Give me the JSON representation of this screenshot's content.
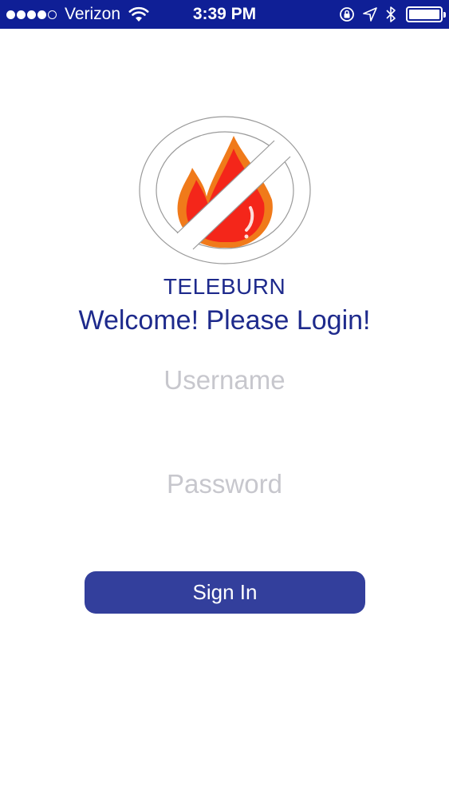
{
  "status_bar": {
    "carrier": "Verizon",
    "time": "3:39 PM",
    "signal_bars_filled": 4,
    "signal_bars_total": 5,
    "icons": [
      "wifi-icon",
      "rotation-lock-icon",
      "location-arrow-icon",
      "bluetooth-icon",
      "battery-icon"
    ],
    "battery_level": 1.0,
    "background_color": "#0f1f96"
  },
  "logo": {
    "icon": "no-fire-icon",
    "flame_color": "#f4261a",
    "flame_outline_color": "#f07a1a"
  },
  "header": {
    "app_name": "TELEBURN",
    "welcome": "Welcome! Please Login!",
    "text_color": "#1e2a8c"
  },
  "form": {
    "username_placeholder": "Username",
    "username_value": "",
    "password_placeholder": "Password",
    "password_value": "",
    "sign_in_label": "Sign In",
    "button_color": "#333f9c"
  }
}
